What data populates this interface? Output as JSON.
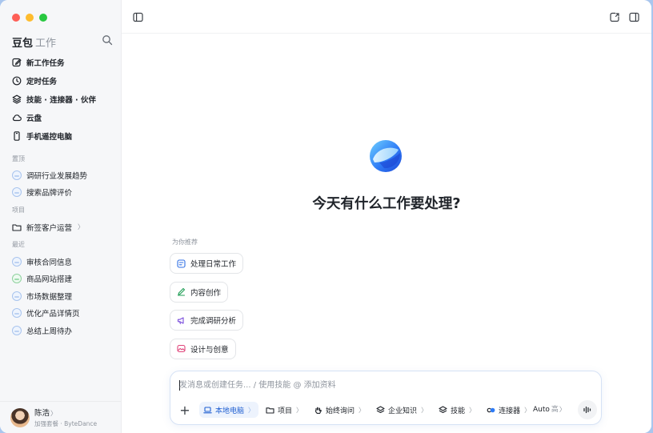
{
  "sidebar": {
    "brand": "豆包",
    "brand_sub": "工作",
    "nav": [
      {
        "label": "新工作任务",
        "icon": "edit-icon"
      },
      {
        "label": "定时任务",
        "icon": "clock-icon"
      },
      {
        "label": "技能 · 连接器 · 伙伴",
        "icon": "layers-icon"
      },
      {
        "label": "云盘",
        "icon": "cloud-icon"
      },
      {
        "label": "手机遥控电脑",
        "icon": "phone-icon"
      }
    ],
    "pinned_label": "置顶",
    "pinned": [
      {
        "label": "调研行业发展趋势"
      },
      {
        "label": "搜索品牌评价"
      }
    ],
    "projects_label": "项目",
    "projects": [
      {
        "label": "新签客户运营",
        "chevron": "〉"
      }
    ],
    "recent_label": "最近",
    "recent": [
      {
        "label": "审核合同信息",
        "color": "blue"
      },
      {
        "label": "商品网站搭建",
        "color": "green"
      },
      {
        "label": "市场数据整理",
        "color": "blue"
      },
      {
        "label": "优化产品详情页",
        "color": "blue"
      },
      {
        "label": "总结上周待办",
        "color": "blue"
      }
    ],
    "user": {
      "name": "陈浩",
      "chevron": "〉",
      "subtitle": "加强套餐 · ByteDance"
    }
  },
  "main": {
    "headline": "今天有什么工作要处理?",
    "recommend_label": "为你推荐",
    "recommendations": [
      {
        "label": "处理日常工作",
        "icon": "task-icon"
      },
      {
        "label": "内容创作",
        "icon": "pen-icon"
      },
      {
        "label": "完成调研分析",
        "icon": "megaphone-icon"
      },
      {
        "label": "设计与创意",
        "icon": "image-icon"
      }
    ],
    "composer": {
      "placeholder": "发消息或创建任务... / 使用技能 @ 添加资料",
      "tools": [
        {
          "label": "本地电脑",
          "active": true,
          "icon": "laptop-icon"
        },
        {
          "label": "项目",
          "active": false,
          "icon": "folder-icon"
        },
        {
          "label": "始终询问",
          "active": false,
          "icon": "hand-icon"
        },
        {
          "label": "企业知识",
          "active": false,
          "icon": "layers-icon"
        },
        {
          "label": "技能",
          "active": false,
          "icon": "layers-icon"
        },
        {
          "label": "连接器",
          "active": false,
          "icon": "connector-icon"
        }
      ],
      "chevron": "〉",
      "model": "Auto",
      "model_level": "高",
      "model_chevron": "〉"
    }
  },
  "colors": {
    "accent": "#1f5fd1",
    "active_bg": "#edf3fd",
    "sidebar_bg": "#f6f7f9"
  }
}
